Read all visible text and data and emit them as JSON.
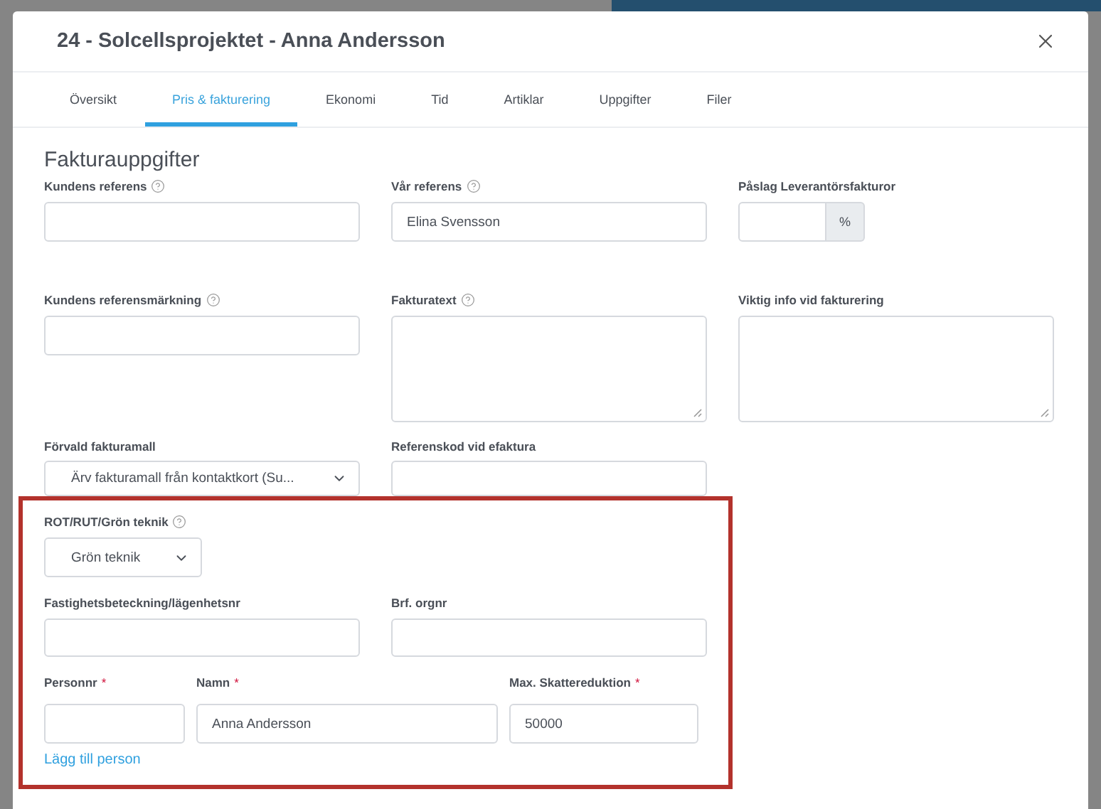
{
  "dialog": {
    "title": "24 - Solcellsprojektet - Anna Andersson"
  },
  "tabs": [
    {
      "label": "Översikt",
      "selected": false
    },
    {
      "label": "Pris & fakturering",
      "selected": true
    },
    {
      "label": "Ekonomi",
      "selected": false
    },
    {
      "label": "Tid",
      "selected": false
    },
    {
      "label": "Artiklar",
      "selected": false
    },
    {
      "label": "Uppgifter",
      "selected": false
    },
    {
      "label": "Filer",
      "selected": false
    }
  ],
  "section": {
    "title": "Fakturauppgifter"
  },
  "rows": [
    [
      {
        "kind": "input",
        "label": "Kundens referens",
        "help": true
      },
      {
        "kind": "input",
        "label": "Vår referens",
        "help": true,
        "value": "Elina Svensson"
      },
      {
        "kind": "addon",
        "label": "Påslag Leverantörsfakturor",
        "addon": "%"
      }
    ],
    [
      {
        "kind": "input",
        "label": "Kundens referensmärkning",
        "help": true
      },
      {
        "kind": "textarea",
        "label": "Fakturatext",
        "help": true
      },
      {
        "kind": "textarea",
        "label": "Viktig info vid fakturering"
      }
    ],
    [
      {
        "kind": "select",
        "label": "Förvald fakturamall",
        "value": "Ärv fakturamall från kontaktkort (Su..."
      },
      {
        "kind": "input",
        "label": "Referenskod vid efaktura"
      }
    ]
  ],
  "tax": {
    "highlighted": true,
    "type": {
      "label": "ROT/RUT/Grön teknik",
      "help": true,
      "value": "Grön teknik"
    },
    "property": [
      {
        "label": "Fastighetsbeteckning/lägenhetsnr"
      },
      {
        "label": "Brf. orgnr"
      }
    ],
    "persons": [
      {
        "label": "Personnr",
        "required_mark": "*"
      },
      {
        "label": "Namn",
        "required_mark": "*",
        "value": "Anna Andersson"
      },
      {
        "label": "Max. Skattereduktion",
        "required_mark": "*",
        "value": "50000"
      }
    ],
    "add_link": "Lägg till person"
  }
}
